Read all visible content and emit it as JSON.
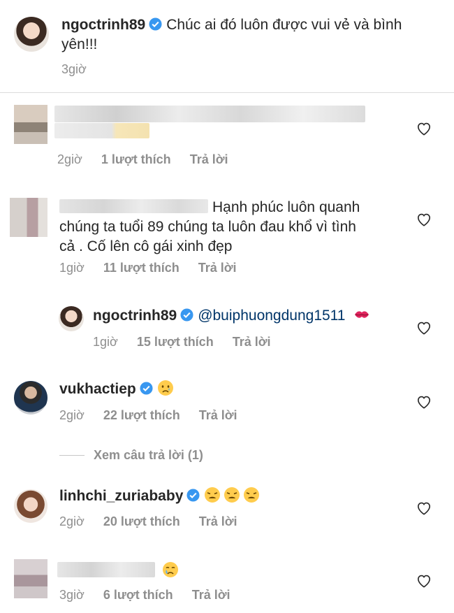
{
  "post": {
    "username": "ngoctrinh89",
    "caption": "Chúc ai đó luôn được vui vẻ và bình yên!!!",
    "time": "3giờ"
  },
  "comments": [
    {
      "text": "",
      "time": "2giờ",
      "likes": "1 lượt thích",
      "reply_label": "Trả lời"
    },
    {
      "text_line1": "Hạnh phúc luôn quanh",
      "text_line2": "chúng ta tuổi 89 chúng ta luôn đau khổ vì tình",
      "text_line3": "cả . Cố lên cô gái xinh đẹp",
      "time": "1giờ",
      "likes": "11 lượt thích",
      "reply_label": "Trả lời"
    }
  ],
  "reply": {
    "username": "ngoctrinh89",
    "mention": "@buiphuongdung1511",
    "emoji": "kiss-mark",
    "time": "1giờ",
    "likes": "15 lượt thích",
    "reply_label": "Trả lời"
  },
  "comment3": {
    "username": "vukhactiep",
    "emoji": "sad-face",
    "time": "2giờ",
    "likes": "22 lượt thích",
    "reply_label": "Trả lời",
    "view_replies": "Xem câu trả lời (1)"
  },
  "comment4": {
    "username": "linhchi_zuriababy",
    "emoji": "weary-face x3",
    "time": "2giờ",
    "likes": "20 lượt thích",
    "reply_label": "Trả lời"
  },
  "comment5": {
    "emoji": "crying-face",
    "time": "3giờ",
    "likes": "6 lượt thích",
    "reply_label": "Trả lời"
  }
}
